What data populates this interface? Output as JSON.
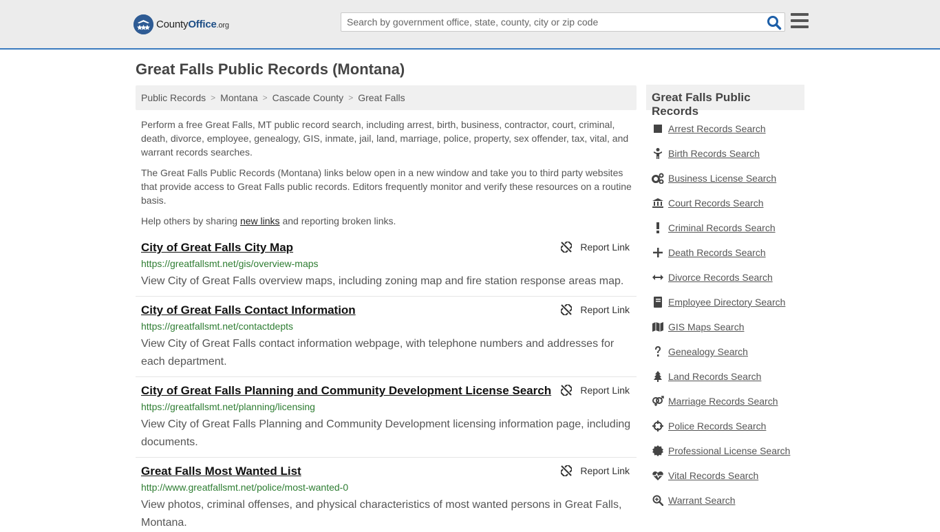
{
  "header": {
    "logo_name": "County",
    "logo_office": "Office",
    "logo_tld": ".org",
    "search_placeholder": "Search by government office, state, county, city or zip code"
  },
  "page_title": "Great Falls Public Records (Montana)",
  "breadcrumb": [
    "Public Records",
    "Montana",
    "Cascade County",
    "Great Falls"
  ],
  "intro": {
    "p1": "Perform a free Great Falls, MT public record search, including arrest, birth, business, contractor, court, criminal, death, divorce, employee, genealogy, GIS, inmate, jail, land, marriage, police, property, sex offender, tax, vital, and warrant records searches.",
    "p2": "The Great Falls Public Records (Montana) links below open in a new window and take you to third party websites that provide access to Great Falls public records. Editors frequently monitor and verify these resources on a routine basis.",
    "p3_before": "Help others by sharing ",
    "p3_link": "new links",
    "p3_after": " and reporting broken links."
  },
  "report_label": "Report Link",
  "listings": [
    {
      "title": "City of Great Falls City Map",
      "url": "https://greatfallsmt.net/gis/overview-maps",
      "desc": "View City of Great Falls overview maps, including zoning map and fire station response areas map."
    },
    {
      "title": "City of Great Falls Contact Information",
      "url": "https://greatfallsmt.net/contactdepts",
      "desc": "View City of Great Falls contact information webpage, with telephone numbers and addresses for each department."
    },
    {
      "title": "City of Great Falls Planning and Community Development License Search",
      "url": "https://greatfallsmt.net/planning/licensing",
      "desc": "View City of Great Falls Planning and Community Development licensing information page, including documents."
    },
    {
      "title": "Great Falls Most Wanted List",
      "url": "http://www.greatfallsmt.net/police/most-wanted-0",
      "desc": "View photos, criminal offenses, and physical characteristics of most wanted persons in Great Falls, Montana."
    }
  ],
  "sidebar": {
    "title": "Great Falls Public Records",
    "items": [
      {
        "label": "Arrest Records Search",
        "icon": "square-icon"
      },
      {
        "label": "Birth Records Search",
        "icon": "child-icon"
      },
      {
        "label": "Business License Search",
        "icon": "gears-icon"
      },
      {
        "label": "Court Records Search",
        "icon": "courthouse-icon"
      },
      {
        "label": "Criminal Records Search",
        "icon": "exclamation-icon"
      },
      {
        "label": "Death Records Search",
        "icon": "plus-icon"
      },
      {
        "label": "Divorce Records Search",
        "icon": "arrows-horizontal-icon"
      },
      {
        "label": "Employee Directory Search",
        "icon": "book-icon"
      },
      {
        "label": "GIS Maps Search",
        "icon": "map-icon"
      },
      {
        "label": "Genealogy Search",
        "icon": "question-icon"
      },
      {
        "label": "Land Records Search",
        "icon": "tree-icon"
      },
      {
        "label": "Marriage Records Search",
        "icon": "gender-icon"
      },
      {
        "label": "Police Records Search",
        "icon": "crosshairs-icon"
      },
      {
        "label": "Professional License Search",
        "icon": "certificate-icon"
      },
      {
        "label": "Vital Records Search",
        "icon": "heartbeat-icon"
      },
      {
        "label": "Warrant Search",
        "icon": "search-plus-icon"
      }
    ]
  }
}
